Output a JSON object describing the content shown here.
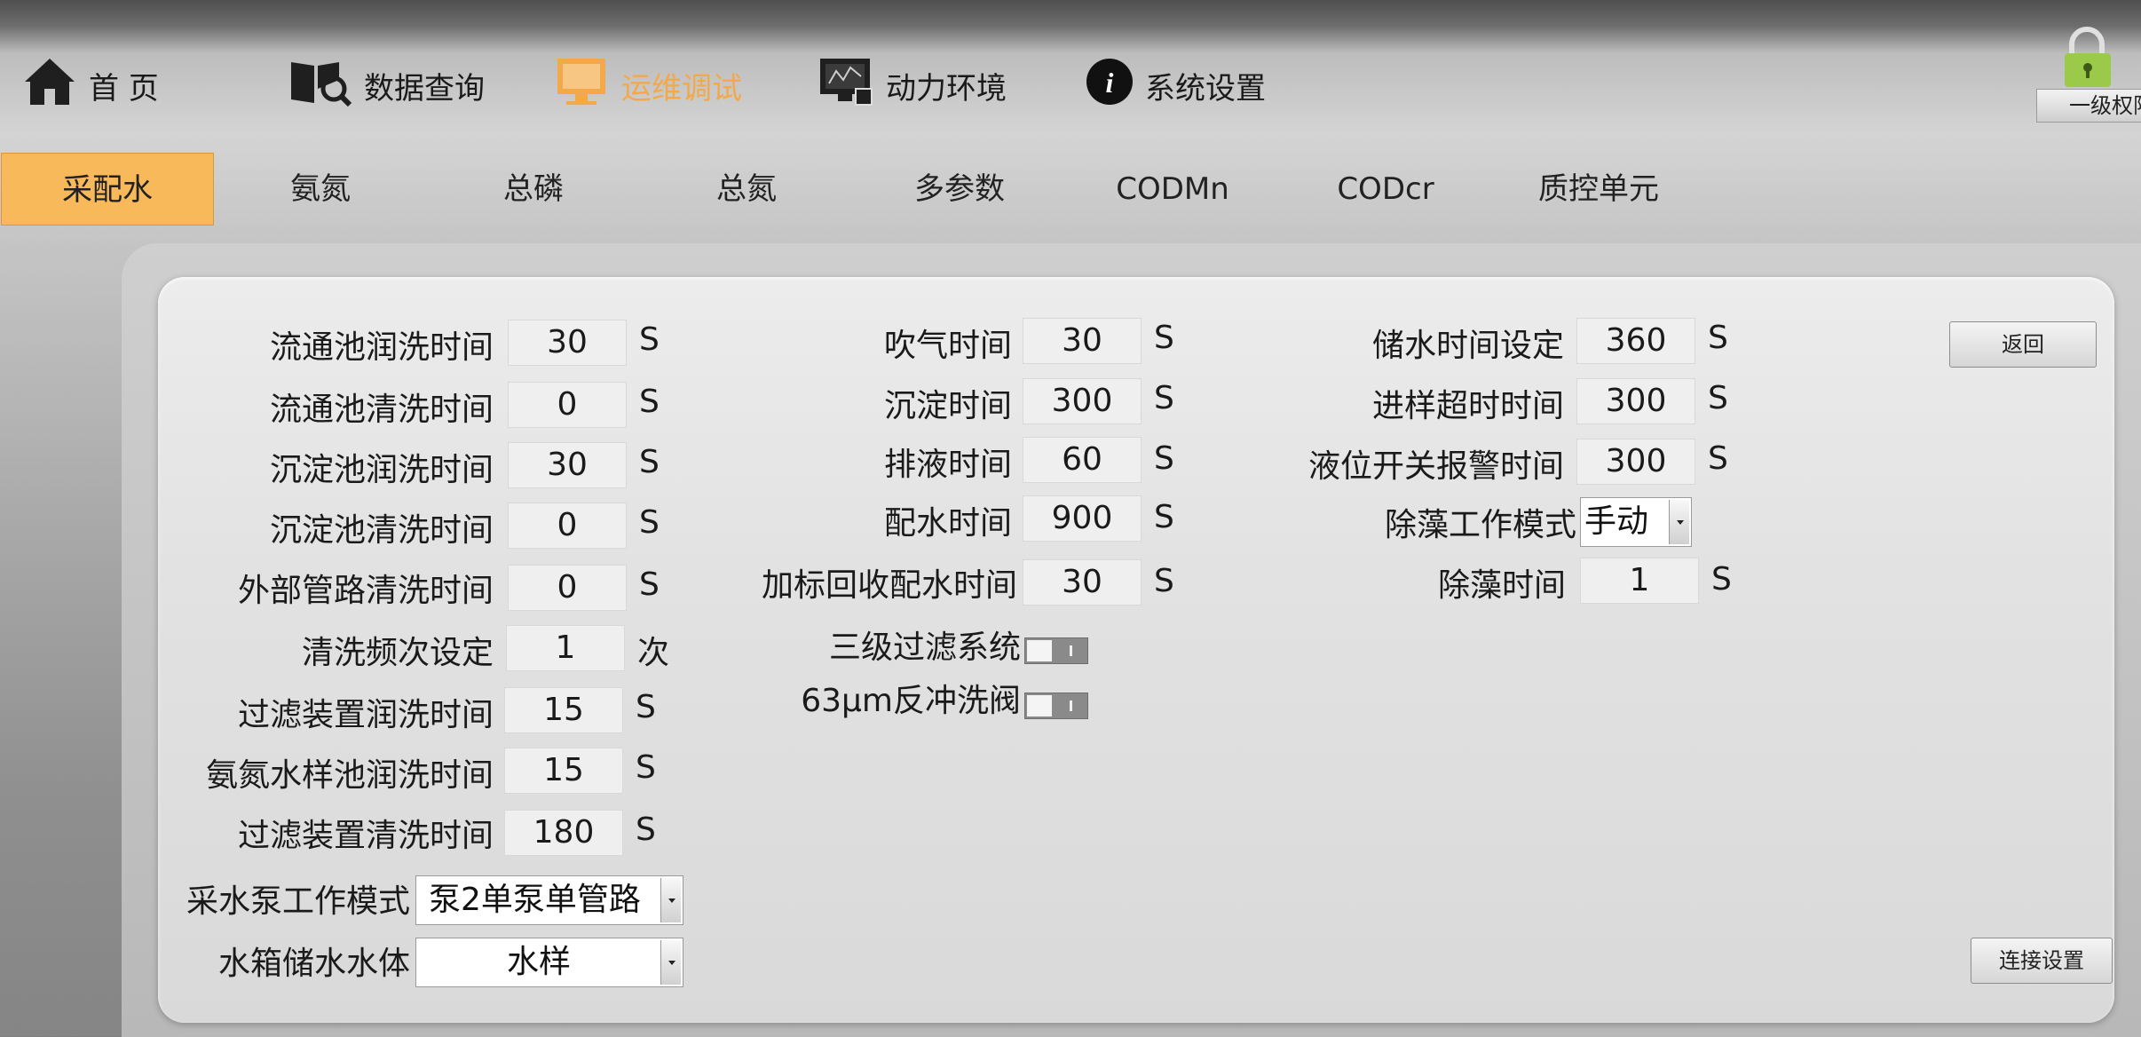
{
  "nav": {
    "items": [
      {
        "label": "首 页",
        "icon": "home-icon"
      },
      {
        "label": "数据查询",
        "icon": "data-search-icon"
      },
      {
        "label": "运维调试",
        "icon": "maintenance-monitor-icon"
      },
      {
        "label": "动力环境",
        "icon": "power-monitor-icon"
      },
      {
        "label": "系统设置",
        "icon": "info-icon"
      }
    ],
    "active_color": "#f3a94a"
  },
  "permission": {
    "label": "一级权限"
  },
  "tabs": [
    "采配水",
    "氨氮",
    "总磷",
    "总氮",
    "多参数",
    "CODMn",
    "CODcr",
    "质控单元"
  ],
  "active_tab_color": "#f7b95a",
  "left_fields": [
    {
      "label": "流通池润洗时间",
      "value": "30",
      "unit": "S"
    },
    {
      "label": "流通池清洗时间",
      "value": "0",
      "unit": "S"
    },
    {
      "label": "沉淀池润洗时间",
      "value": "30",
      "unit": "S"
    },
    {
      "label": "沉淀池清洗时间",
      "value": "0",
      "unit": "S"
    },
    {
      "label": "外部管路清洗时间",
      "value": "0",
      "unit": "S"
    },
    {
      "label": "清洗频次设定",
      "value": "1",
      "unit": "次"
    },
    {
      "label": "过滤装置润洗时间",
      "value": "15",
      "unit": "S"
    },
    {
      "label": "氨氮水样池润洗时间",
      "value": "15",
      "unit": "S"
    },
    {
      "label": "过滤装置清洗时间",
      "value": "180",
      "unit": "S"
    }
  ],
  "left_selects": [
    {
      "label": "采水泵工作模式",
      "value": "泵2单泵单管路"
    },
    {
      "label": "水箱储水水体",
      "value": "水样"
    }
  ],
  "mid_fields": [
    {
      "label": "吹气时间",
      "value": "30",
      "unit": "S"
    },
    {
      "label": "沉淀时间",
      "value": "300",
      "unit": "S"
    },
    {
      "label": "排液时间",
      "value": "60",
      "unit": "S"
    },
    {
      "label": "配水时间",
      "value": "900",
      "unit": "S"
    },
    {
      "label": "加标回收配水时间",
      "value": "30",
      "unit": "S"
    }
  ],
  "mid_toggles": [
    {
      "label": "三级过滤系统"
    },
    {
      "label": "63μm反冲洗阀"
    }
  ],
  "right_fields": [
    {
      "label": "储水时间设定",
      "value": "360",
      "unit": "S"
    },
    {
      "label": "进样超时时间",
      "value": "300",
      "unit": "S"
    },
    {
      "label": "液位开关报警时间",
      "value": "300",
      "unit": "S"
    }
  ],
  "right_select": {
    "label": "除藻工作模式",
    "value": "手动"
  },
  "right_field_last": {
    "label": "除藻时间",
    "value": "1",
    "unit": "S"
  },
  "buttons": {
    "back": "返回",
    "connect": "连接设置"
  }
}
